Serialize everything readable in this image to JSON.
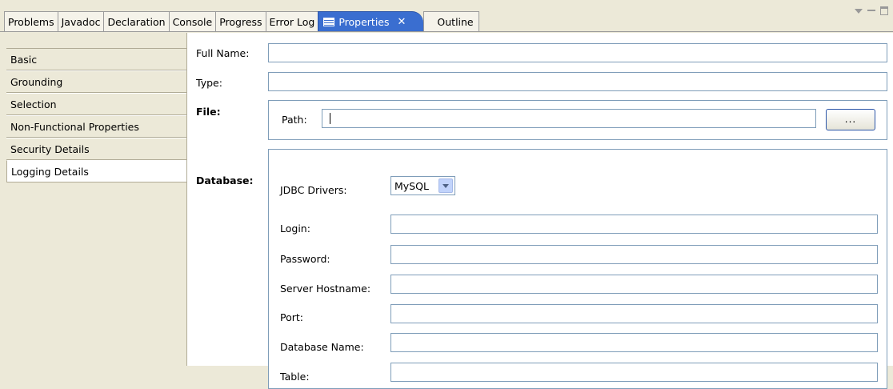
{
  "tabs": [
    {
      "label": "Problems"
    },
    {
      "label": "Javadoc"
    },
    {
      "label": "Declaration"
    },
    {
      "label": "Console"
    },
    {
      "label": "Progress"
    },
    {
      "label": "Error Log"
    },
    {
      "label": "Properties",
      "active": true
    },
    {
      "label": "Outline"
    }
  ],
  "colors": {
    "active_tab": "#3a6ed0",
    "panel_bg": "#ece9d8",
    "field_border": "#7f9db9"
  },
  "sections": {
    "items": [
      "Basic",
      "Grounding",
      "Selection",
      "Non-Functional Properties",
      "Security Details",
      "Logging Details"
    ],
    "selected": "Logging Details"
  },
  "form": {
    "full_name_label": "Full Name:",
    "full_name_value": "",
    "type_label": "Type:",
    "type_value": "",
    "file_label": "File:",
    "path_label": "Path:",
    "path_value": "",
    "browse_label": "...",
    "database_label": "Database:",
    "jdbc_label": "JDBC Drivers:",
    "jdbc_value": "MySQL",
    "login_label": "Login:",
    "password_label": "Password:",
    "hostname_label": "Server Hostname:",
    "port_label": "Port:",
    "dbname_label": "Database Name:",
    "table_label": "Table:"
  }
}
